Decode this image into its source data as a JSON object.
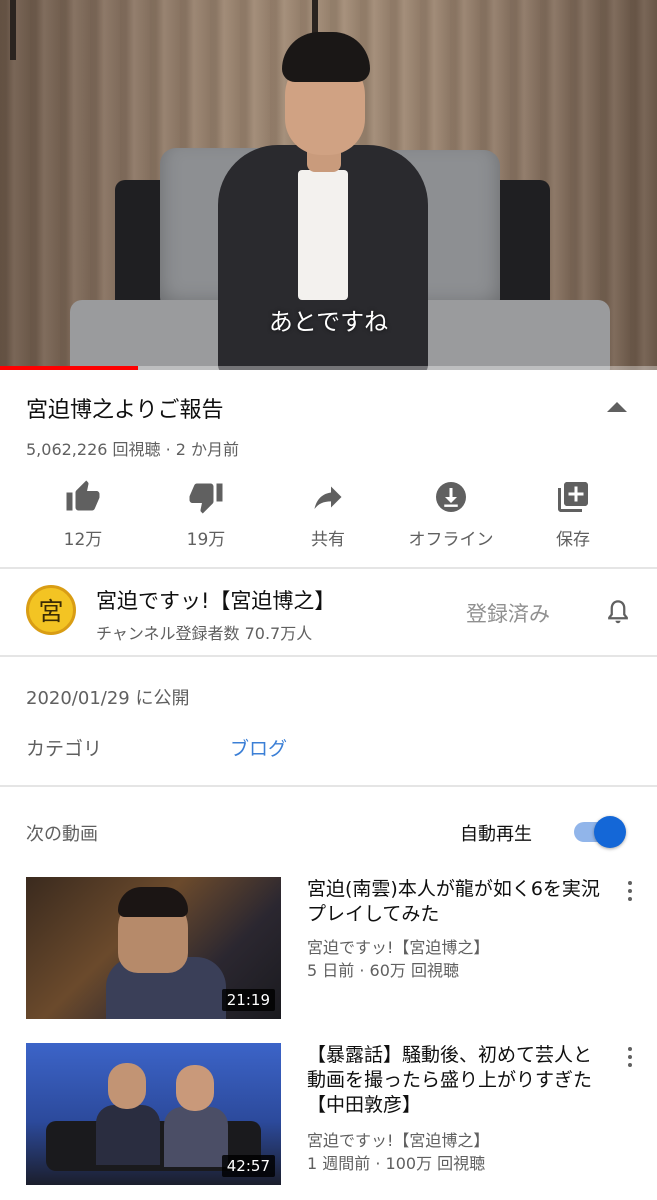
{
  "player": {
    "subtitle": "あとですね",
    "progress_fraction": 0.21
  },
  "video": {
    "title": "宮迫博之よりご報告",
    "meta": "5,062,226 回視聴 · 2 か月前"
  },
  "actions": {
    "like_label": "12万",
    "dislike_label": "19万",
    "share_label": "共有",
    "offline_label": "オフライン",
    "save_label": "保存"
  },
  "channel": {
    "avatar_text": "宮",
    "name": "宮迫ですッ!【宮迫博之】",
    "subscribers": "チャンネル登録者数 70.7万人",
    "subscribed_label": "登録済み"
  },
  "description": {
    "published": "2020/01/29 に公開",
    "category_label": "カテゴリ",
    "category_value": "ブログ"
  },
  "up_next": {
    "label": "次の動画",
    "autoplay_label": "自動再生",
    "autoplay_on": true
  },
  "videos": [
    {
      "title": "宮迫(南雲)本人が龍が如く6を実況プレイしてみた",
      "channel": "宮迫ですッ!【宮迫博之】",
      "meta": "5 日前 · 60万 回視聴",
      "duration": "21:19"
    },
    {
      "title": "【暴露話】騒動後、初めて芸人と動画を撮ったら盛り上がりすぎた【中田敦彦】",
      "channel": "宮迫ですッ!【宮迫博之】",
      "meta": "1 週間前 · 100万 回視聴",
      "duration": "42:57"
    }
  ],
  "colors": {
    "progress": "#ff0000",
    "toggle_knob": "#1467d7",
    "link": "#3b7fd6",
    "avatar_bg": "#f3c423"
  }
}
